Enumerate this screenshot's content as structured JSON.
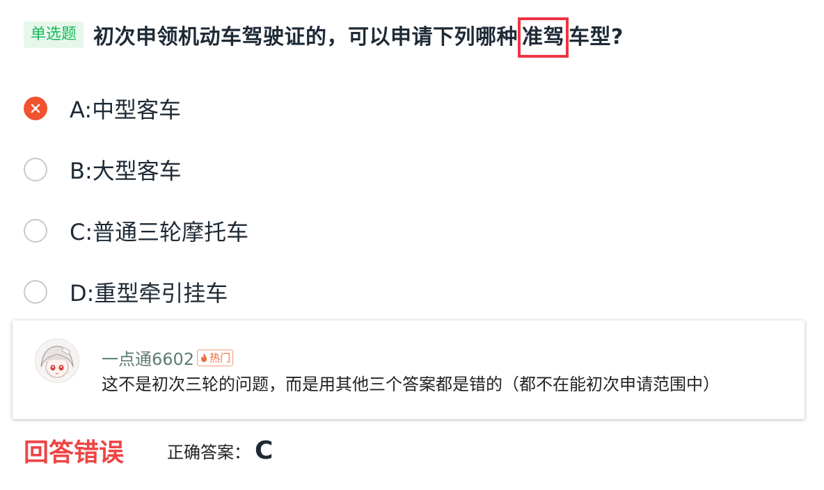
{
  "question": {
    "type_badge": "单选题",
    "text_before": "初次申领机动车驾驶证的，可以申请下列哪种",
    "text_highlight": "准驾",
    "text_after": "车型?"
  },
  "options": [
    {
      "label": "A:中型客车",
      "state": "wrong"
    },
    {
      "label": "B:大型客车",
      "state": "unselected"
    },
    {
      "label": "C:普通三轮摩托车",
      "state": "unselected"
    },
    {
      "label": "D:重型牵引挂车",
      "state": "unselected"
    }
  ],
  "comment": {
    "username": "一点通6602",
    "badge": "热门",
    "text": "这不是初次三轮的问题，而是用其他三个答案都是错的（都不在能初次申请范围中）"
  },
  "result": {
    "status": "回答错误",
    "answer_label": "正确答案：",
    "answer_value": "C"
  },
  "colors": {
    "wrong": "#f2522f",
    "highlight_border": "#ee3344",
    "badge_green": "#18b85a",
    "status_red": "#ee4444"
  }
}
